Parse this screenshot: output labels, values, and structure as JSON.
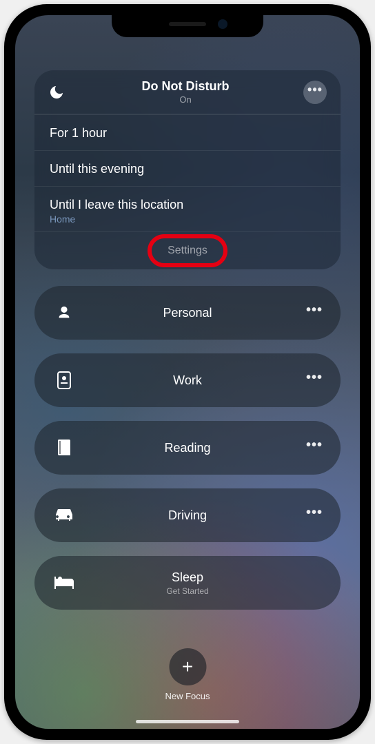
{
  "dnd": {
    "title": "Do Not Disturb",
    "status": "On",
    "more_icon": "more-horizontal",
    "options": [
      {
        "label": "For 1 hour"
      },
      {
        "label": "Until this evening"
      },
      {
        "label": "Until I leave this location",
        "hint": "Home"
      }
    ],
    "settings_label": "Settings"
  },
  "focus_modes": [
    {
      "icon": "person",
      "label": "Personal",
      "sublabel": null,
      "has_more": true
    },
    {
      "icon": "work",
      "label": "Work",
      "sublabel": null,
      "has_more": true
    },
    {
      "icon": "book",
      "label": "Reading",
      "sublabel": null,
      "has_more": true
    },
    {
      "icon": "car",
      "label": "Driving",
      "sublabel": null,
      "has_more": true
    },
    {
      "icon": "bed",
      "label": "Sleep",
      "sublabel": "Get Started",
      "has_more": false
    }
  ],
  "new_focus": {
    "label": "New Focus"
  },
  "annotation": {
    "highlight_target": "settings_label",
    "color": "#e50012"
  }
}
